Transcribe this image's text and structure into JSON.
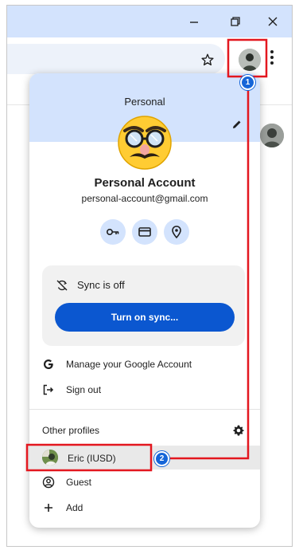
{
  "window": {
    "minimize_icon": "minimize-icon",
    "restore_icon": "restore-icon",
    "close_icon": "close-icon",
    "title_bar_color": "#d3e3fd"
  },
  "toolbar": {
    "bookmark_icon": "star-icon",
    "menu_icon": "kebab-menu-icon"
  },
  "profile_menu": {
    "profile_label": "Personal",
    "account_name": "Personal Account",
    "account_email": "personal-account@gmail.com",
    "quick_actions": [
      "password-key-icon",
      "payment-card-icon",
      "location-pin-icon"
    ],
    "sync_status": "Sync is off",
    "sync_button": "Turn on sync...",
    "manage_account": "Manage your Google Account",
    "sign_out": "Sign out",
    "other_profiles_title": "Other profiles",
    "other_profiles": [
      {
        "label": "Eric (IUSD)"
      }
    ],
    "guest": "Guest",
    "add": "Add",
    "accent_color": "#0b57d0"
  },
  "annotations": {
    "step_1": "1",
    "step_2": "2",
    "highlight_color": "#e3171f",
    "badge_color": "#1565d8"
  }
}
